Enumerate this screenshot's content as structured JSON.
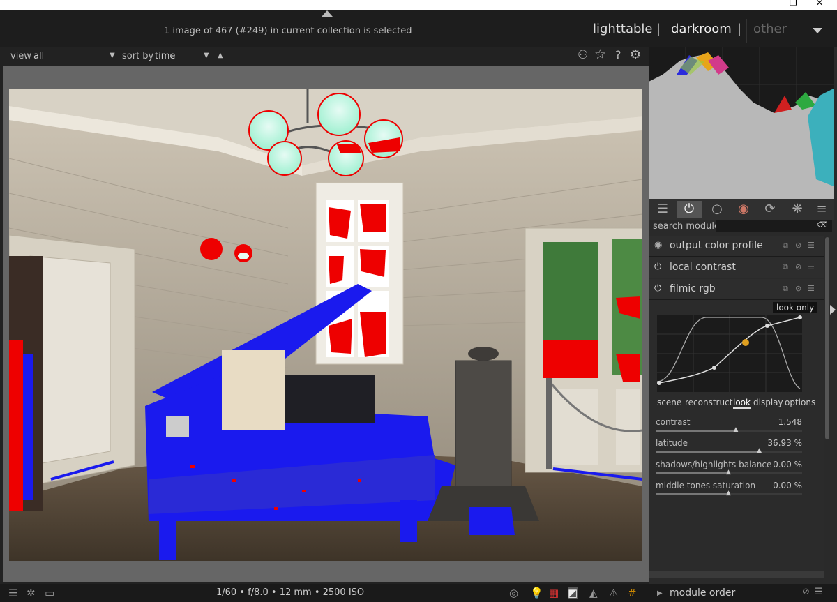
{
  "window": {
    "min": "—",
    "restore": "❐",
    "close": "✕"
  },
  "topbar": {
    "info": "1 image of 467 (#249) in current collection is selected",
    "views": {
      "lighttable": "lighttable",
      "darkroom": "darkroom",
      "other": "other",
      "sep": "|"
    }
  },
  "filter": {
    "view_label": "view",
    "view_value": "all",
    "sort_label": "sort by",
    "sort_value": "time"
  },
  "tabs": [
    {
      "icon": "sliders-icon",
      "glyph": "☰"
    },
    {
      "icon": "power-icon",
      "glyph": "⏻"
    },
    {
      "icon": "circle-icon",
      "glyph": "○"
    },
    {
      "icon": "color-wheel-icon",
      "glyph": "◉"
    },
    {
      "icon": "correct-icon",
      "glyph": "⟳"
    },
    {
      "icon": "effect-icon",
      "glyph": "❋"
    },
    {
      "icon": "menu-icon",
      "glyph": "≡"
    }
  ],
  "search": {
    "label": "search module"
  },
  "modules": [
    {
      "name": "output color profile"
    },
    {
      "name": "local contrast"
    },
    {
      "name": "filmic rgb"
    }
  ],
  "filmic": {
    "tooltip": "look only",
    "tabs": [
      "scene",
      "reconstruct",
      "look",
      "display",
      "options"
    ],
    "active_tab": "look",
    "sliders": [
      {
        "label": "contrast",
        "value": "1.548",
        "level": 0.55
      },
      {
        "label": "latitude",
        "value": "36.93 %",
        "level": 0.71
      },
      {
        "label": "shadows/highlights balance",
        "value": "0.00 %",
        "level": 0.5
      },
      {
        "label": "middle tones saturation",
        "value": "0.00 %",
        "level": 0.5
      }
    ]
  },
  "bottombar": {
    "exposure": "1/60 • f/8.0 • 12 mm • 2500 ISO",
    "module_order": "module order"
  },
  "colors": {
    "overexposed": "#ff0000",
    "underexposed": "#0000ff",
    "accent": "#e0a020"
  }
}
